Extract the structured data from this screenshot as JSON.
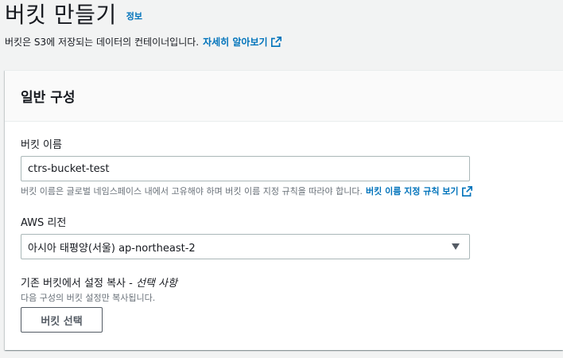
{
  "header": {
    "title": "버킷 만들기",
    "info_label": "정보",
    "description": "버킷은 S3에 저장되는 데이터의 컨테이너입니다.",
    "learn_more_label": "자세히 알아보기"
  },
  "section": {
    "title": "일반 구성",
    "bucket_name": {
      "label": "버킷 이름",
      "value": "ctrs-bucket-test",
      "hint": "버킷 이름은 글로벌 네임스페이스 내에서 고유해야 하며 버킷 이름 지정 규칙을 따라야 합니다.",
      "rules_link_label": "버킷 이름 지정 규칙 보기"
    },
    "region": {
      "label": "AWS 리전",
      "selected": "아시아 태평양(서울) ap-northeast-2"
    },
    "copy_settings": {
      "label": "기존 버킷에서 설정 복사 -",
      "optional": "선택 사항",
      "hint": "다음 구성의 버킷 설정만 복사됩니다.",
      "button_label": "버킷 선택"
    }
  },
  "colors": {
    "link": "#0073bb",
    "text": "#16191f",
    "hint": "#687078",
    "background": "#f2f3f3"
  },
  "icons": [
    "external-link-icon",
    "caret-down-icon"
  ]
}
